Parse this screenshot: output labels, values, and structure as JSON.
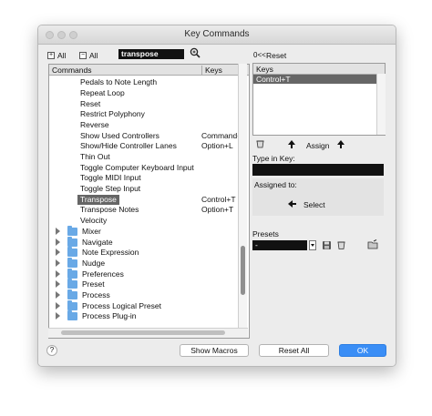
{
  "window": {
    "title": "Key Commands"
  },
  "toolbar": {
    "all_plus": "All",
    "all_minus": "All",
    "search_value": "transpose",
    "reset_label": "Reset"
  },
  "list": {
    "col_commands": "Commands",
    "col_keys": "Keys",
    "commands": [
      {
        "label": "Pedals to Note Length",
        "key": ""
      },
      {
        "label": "Repeat Loop",
        "key": ""
      },
      {
        "label": "Reset",
        "key": ""
      },
      {
        "label": "Restrict Polyphony",
        "key": ""
      },
      {
        "label": "Reverse",
        "key": ""
      },
      {
        "label": "Show Used Controllers",
        "key": "Command+"
      },
      {
        "label": "Show/Hide Controller Lanes",
        "key": "Option+L"
      },
      {
        "label": "Thin Out",
        "key": ""
      },
      {
        "label": "Toggle Computer Keyboard Input",
        "key": ""
      },
      {
        "label": "Toggle MIDI Input",
        "key": ""
      },
      {
        "label": "Toggle Step Input",
        "key": ""
      },
      {
        "label": "Transpose",
        "key": "Control+T"
      },
      {
        "label": "Transpose Notes",
        "key": "Option+T"
      },
      {
        "label": "Velocity",
        "key": ""
      }
    ],
    "groups": [
      "Mixer",
      "Navigate",
      "Note Expression",
      "Nudge",
      "Preferences",
      "Preset",
      "Process",
      "Process Logical Preset",
      "Process Plug-in"
    ]
  },
  "keys_panel": {
    "header": "Keys",
    "selected_key": "Control+T",
    "assign_label": "Assign",
    "type_in_key_label": "Type in Key:",
    "assigned_to_label": "Assigned to:",
    "select_label": "Select"
  },
  "presets": {
    "label": "Presets",
    "value": "-"
  },
  "footer": {
    "help": "?",
    "show_macros": "Show Macros",
    "reset_all": "Reset All",
    "ok": "OK"
  },
  "colors": {
    "accent": "#3a8ef6",
    "selection": "#666666",
    "folder": "#69a9e6"
  }
}
